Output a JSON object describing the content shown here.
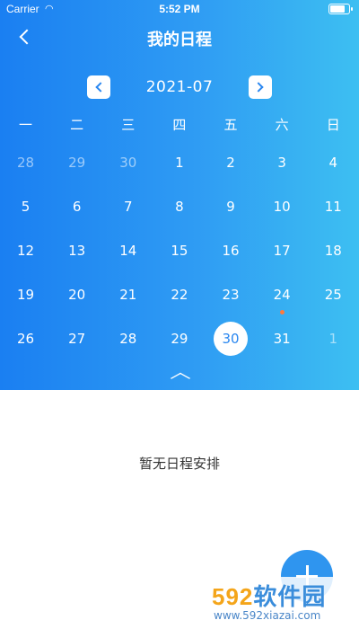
{
  "status_bar": {
    "carrier": "Carrier",
    "time": "5:52 PM",
    "battery_level": 0.9
  },
  "header": {
    "title": "我的日程"
  },
  "calendar": {
    "month_label": "2021-07",
    "weekdays": [
      "一",
      "二",
      "三",
      "四",
      "五",
      "六",
      "日"
    ],
    "weeks": [
      [
        {
          "d": "28",
          "other": true
        },
        {
          "d": "29",
          "other": true
        },
        {
          "d": "30",
          "other": true
        },
        {
          "d": "1"
        },
        {
          "d": "2"
        },
        {
          "d": "3"
        },
        {
          "d": "4"
        }
      ],
      [
        {
          "d": "5"
        },
        {
          "d": "6"
        },
        {
          "d": "7"
        },
        {
          "d": "8"
        },
        {
          "d": "9"
        },
        {
          "d": "10"
        },
        {
          "d": "11"
        }
      ],
      [
        {
          "d": "12"
        },
        {
          "d": "13"
        },
        {
          "d": "14"
        },
        {
          "d": "15"
        },
        {
          "d": "16"
        },
        {
          "d": "17"
        },
        {
          "d": "18"
        }
      ],
      [
        {
          "d": "19"
        },
        {
          "d": "20"
        },
        {
          "d": "21"
        },
        {
          "d": "22"
        },
        {
          "d": "23"
        },
        {
          "d": "24",
          "event": true
        },
        {
          "d": "25"
        }
      ],
      [
        {
          "d": "26"
        },
        {
          "d": "27"
        },
        {
          "d": "28"
        },
        {
          "d": "29"
        },
        {
          "d": "30",
          "selected": true
        },
        {
          "d": "31"
        },
        {
          "d": "1",
          "other": true
        }
      ]
    ],
    "event_dot_color": "#ff7a3c",
    "selected_color": "#2a87f0"
  },
  "schedule": {
    "empty_text": "暂无日程安排"
  },
  "watermark": {
    "logo_digits": "592",
    "logo_text": "软件园",
    "url": "www.592xiazai.com"
  },
  "colors": {
    "gradient_start": "#1a7ff2",
    "gradient_end": "#3dbff2",
    "fab": "#2f95ef"
  }
}
